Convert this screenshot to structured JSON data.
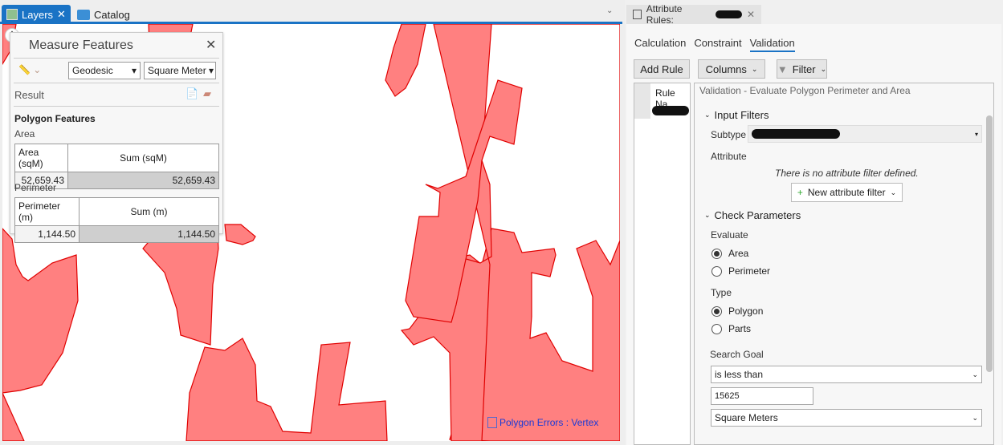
{
  "tabs": [
    {
      "label": "Layers"
    },
    {
      "label": "Catalog"
    }
  ],
  "measure": {
    "title": "Measure Features",
    "method": "Geodesic",
    "unit": "Square Meter",
    "result_label": "Result",
    "section": "Polygon Features",
    "area_label": "Area",
    "area_cols": [
      "Area (sqM)",
      "Sum (sqM)"
    ],
    "area_vals": [
      "52,659.43",
      "52,659.43"
    ],
    "perimeter_label": "Perimeter",
    "perim_cols": [
      "Perimeter (m)",
      "Sum (m)"
    ],
    "perim_vals": [
      "1,144.50",
      "1,144.50"
    ]
  },
  "legend": {
    "label": "Polygon Errors : Vertex"
  },
  "colors": {
    "polygon_fill": "#ff8080",
    "polygon_stroke": "#e00000",
    "accent": "#1a73c5"
  },
  "rules": {
    "tab_label": "Attribute Rules:",
    "subtabs": [
      "Calculation",
      "Constraint",
      "Validation"
    ],
    "add_rule": "Add Rule",
    "columns": "Columns",
    "filter": "Filter",
    "col_header": "Rule Na",
    "rule_title": "Validation - Evaluate Polygon Perimeter and Area",
    "input_filters": "Input Filters",
    "subtype_label": "Subtype",
    "attribute_label": "Attribute",
    "no_filter": "There is no attribute filter defined.",
    "new_filter": "New attribute filter",
    "check_params": "Check Parameters",
    "evaluate_label": "Evaluate",
    "evaluate_opts": [
      "Area",
      "Perimeter"
    ],
    "type_label": "Type",
    "type_opts": [
      "Polygon",
      "Parts"
    ],
    "goal_label": "Search Goal",
    "goal_value": "is less than",
    "threshold": "15625",
    "units_value": "Square Meters"
  }
}
